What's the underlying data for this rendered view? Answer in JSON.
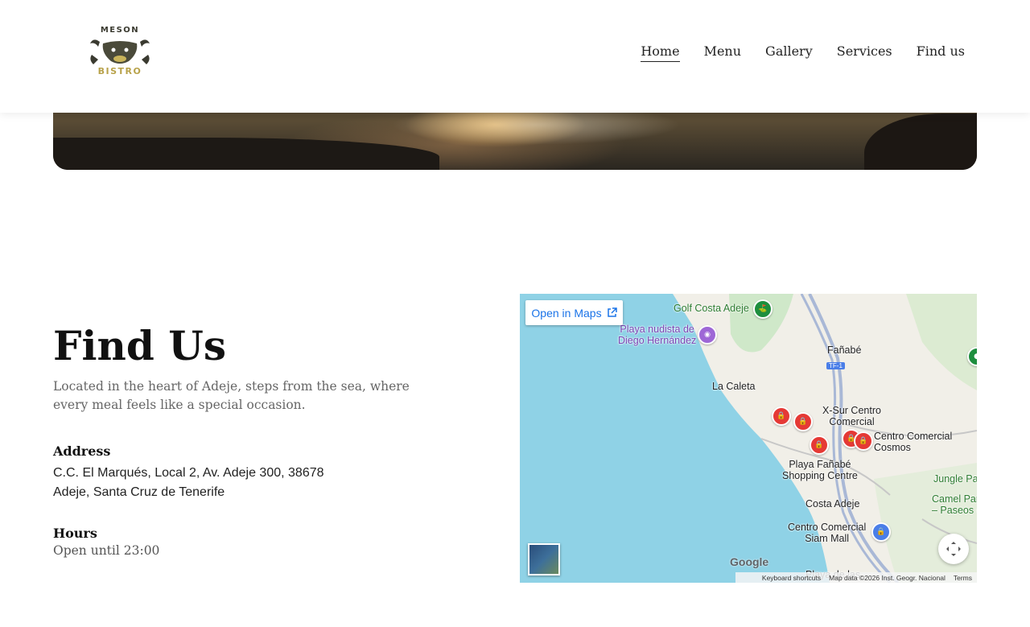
{
  "header": {
    "logo": {
      "top_text": "MESON",
      "bottom_text": "BISTRO"
    },
    "nav": [
      {
        "label": "Home",
        "active": true
      },
      {
        "label": "Menu",
        "active": false
      },
      {
        "label": "Gallery",
        "active": false
      },
      {
        "label": "Services",
        "active": false
      },
      {
        "label": "Find us",
        "active": false
      }
    ]
  },
  "find_us": {
    "title": "Find Us",
    "description": "Located in the heart of Adeje, steps from the sea, where every meal feels like a special occasion.",
    "address_label": "Address",
    "address": "C.C. El Marqués, Local 2, Av. Adeje 300, 38678 Adeje, Santa Cruz de Tenerife",
    "hours_label": "Hours",
    "hours": "Open until 23:00"
  },
  "map": {
    "open_in_maps": "Open in Maps",
    "labels": {
      "golf": "Golf Costa Adeje",
      "playa_nudista_1": "Playa nudista de",
      "playa_nudista_2": "Diego Hernández",
      "fanabe": "Fañabé",
      "tf1": "TF-1",
      "la_caleta": "La Caleta",
      "xsur_1": "X-Sur Centro",
      "xsur_2": "Comercial",
      "cosmos_1": "Centro Comercial",
      "cosmos_2": "Cosmos",
      "playa_fanabe_1": "Playa Fañabé",
      "playa_fanabe_2": "Shopping Centre",
      "jungle": "Jungle Par",
      "camel_1": "Camel Park",
      "camel_2": "– Paseos en ca",
      "costa_adeje": "Costa Adeje",
      "siam_1": "Centro Comercial",
      "siam_2": "Siam Mall",
      "playa_de_las": "Playa de las"
    },
    "google": "Google",
    "attribution": {
      "keyboard": "Keyboard shortcuts",
      "data": "Map data ©2026 Inst. Geogr. Nacional",
      "terms": "Terms"
    },
    "colors": {
      "water": "#8fd2e6",
      "land": "#f1efe8",
      "green": "#cfe8c9",
      "road": "#a9b8d6"
    }
  }
}
